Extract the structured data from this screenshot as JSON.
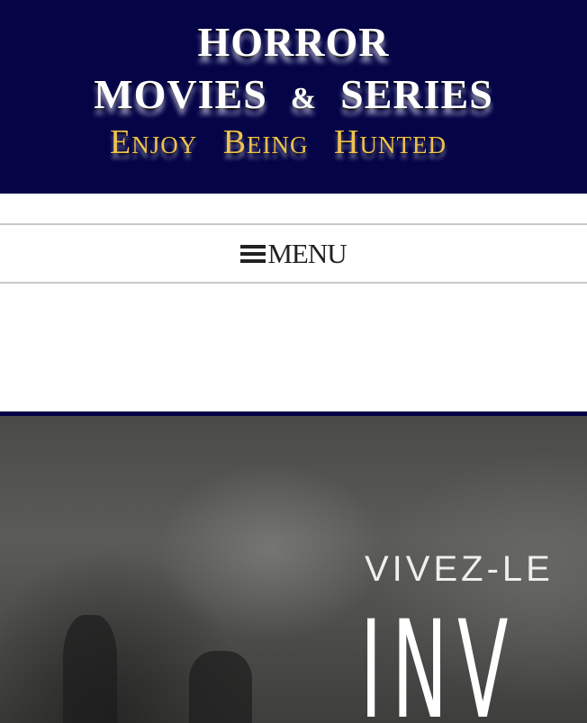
{
  "header": {
    "title_line1": "HORROR",
    "title_line2_a": "MOVIES",
    "title_line2_amp": "&",
    "title_line2_b": "SERIES",
    "tagline": "Enjoy Being Hunted",
    "bg_color": "#040447",
    "tagline_color": "#f0c24f"
  },
  "nav": {
    "menu_label": "MENU",
    "menu_icon": "hamburger-icon"
  },
  "hero": {
    "poster_subtitle": "VIVEZ-LE",
    "poster_title": "INV"
  }
}
